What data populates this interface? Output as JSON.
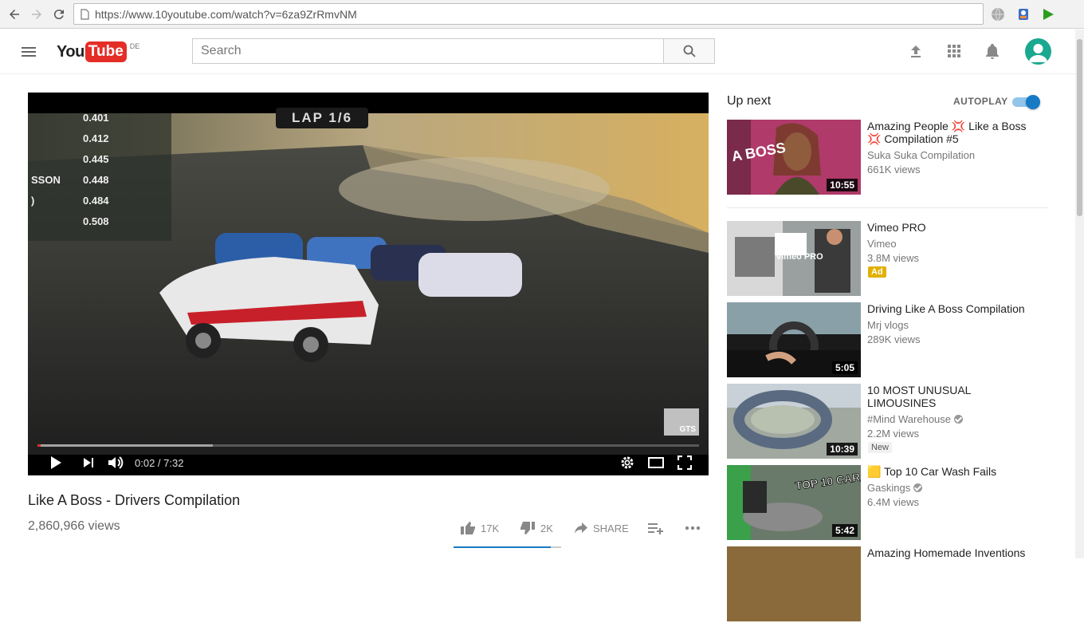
{
  "browser": {
    "url": "https://www.10youtube.com/watch?v=6za9ZrRmvNM"
  },
  "header": {
    "logo_you": "You",
    "logo_tube": "Tube",
    "region": "DE",
    "search_placeholder": "Search"
  },
  "player": {
    "lap_text": "LAP 1/6",
    "timing_tower": [
      {
        "name": "",
        "value": "0.401"
      },
      {
        "name": "",
        "value": "0.412"
      },
      {
        "name": "",
        "value": "0.445"
      },
      {
        "name": "SSON",
        "value": "0.448"
      },
      {
        "name": ")",
        "value": "0.484"
      },
      {
        "name": "",
        "value": "0.508"
      }
    ],
    "watermark": "GTS",
    "time": "0:02 / 7:32",
    "played_fraction": 0.0044,
    "loaded_fraction": 0.265
  },
  "video": {
    "title": "Like A Boss - Drivers Compilation",
    "views": "2,860,966 views",
    "likes": "17K",
    "dislikes": "2K",
    "share_label": "SHARE",
    "like_ratio": 0.9
  },
  "sidebar": {
    "up_next_label": "Up next",
    "autoplay_label": "AUTOPLAY",
    "autoplay_on": true,
    "items": [
      {
        "title": "Amazing People 💢 Like a Boss 💢 Compilation #5",
        "channel": "Suka Suka Compilation",
        "views": "661K views",
        "duration": "10:55"
      },
      {
        "title": "Vimeo PRO",
        "channel": "Vimeo",
        "views": "3.8M views",
        "badge": "Ad",
        "thumb_text": "vimeo PRO"
      },
      {
        "title": "Driving Like A Boss Compilation",
        "channel": "Mrj vlogs",
        "views": "289K views",
        "duration": "5:05"
      },
      {
        "title": "10 MOST UNUSUAL LIMOUSINES",
        "channel": "#Mind Warehouse",
        "views": "2.2M views",
        "badge": "New",
        "duration": "10:39"
      },
      {
        "title": "🟨 Top 10 Car Wash Fails",
        "channel": "Gaskings",
        "views": "6.4M views",
        "duration": "5:42",
        "thumb_text": "TOP 10 CAR WASH FAILS"
      },
      {
        "title": "Amazing Homemade Inventions"
      }
    ],
    "thumb1_text": "A BOSS"
  }
}
